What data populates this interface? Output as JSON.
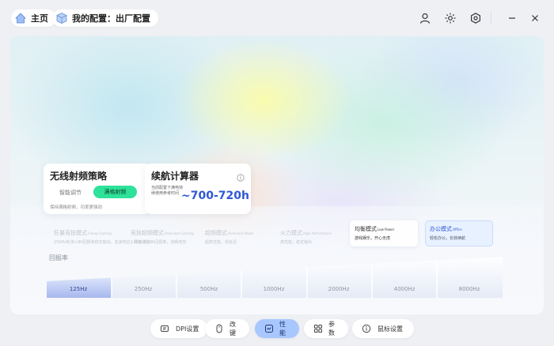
{
  "header": {
    "home_label": "主页",
    "config_label": "我的配置：出厂配置"
  },
  "rf_card": {
    "title": "无线射频策略",
    "smart_label": "智能调节",
    "full_label": "满格射频",
    "desc": "保持满格射频，功率更强劲"
  },
  "battery_card": {
    "title": "续航计算器",
    "desc": "当前配置下满电持续使用参考时间",
    "range": "~700-720h"
  },
  "modes": [
    {
      "name": "狂暴竞技模式",
      "tag": "Frenzy Gaming",
      "desc": "25KHz轮询+8K回报率稳定输出，急速响应，释放潜能"
    },
    {
      "name": "竞技超频模式",
      "tag": "Overclock Gaming",
      "desc": "12K轮询+8K回报率，流畅竞技"
    },
    {
      "name": "超频模式",
      "tag": "Overclock Mode",
      "desc": "超高性能，低延迟"
    },
    {
      "name": "火力模式",
      "tag": "High Performance",
      "desc": "高性能，稳定输出"
    },
    {
      "name": "均衡模式",
      "tag": "Low Power",
      "desc": "游戏娱乐，开心无虑"
    },
    {
      "name": "办公模式",
      "tag": "Office",
      "desc": "轻松办公，长效续航"
    }
  ],
  "report_rate": {
    "label": "回报率",
    "options": [
      "125Hz",
      "250Hz",
      "500Hz",
      "1000Hz",
      "2000Hz",
      "4000Hz",
      "8000Hz"
    ],
    "selected": "125Hz"
  },
  "bottom_nav": [
    {
      "label": "DPI设置",
      "icon": "dpi-icon"
    },
    {
      "label": "改键",
      "icon": "mouse-icon"
    },
    {
      "label": "性能",
      "icon": "performance-icon"
    },
    {
      "label": "参数",
      "icon": "grid-icon"
    },
    {
      "label": "鼠标设置",
      "icon": "info-icon"
    }
  ],
  "bottom_nav_active": "性能",
  "colors": {
    "accent": "#2f57d6",
    "toggle_green": "#2ee29a",
    "active_tab": "#a9c7ff"
  }
}
